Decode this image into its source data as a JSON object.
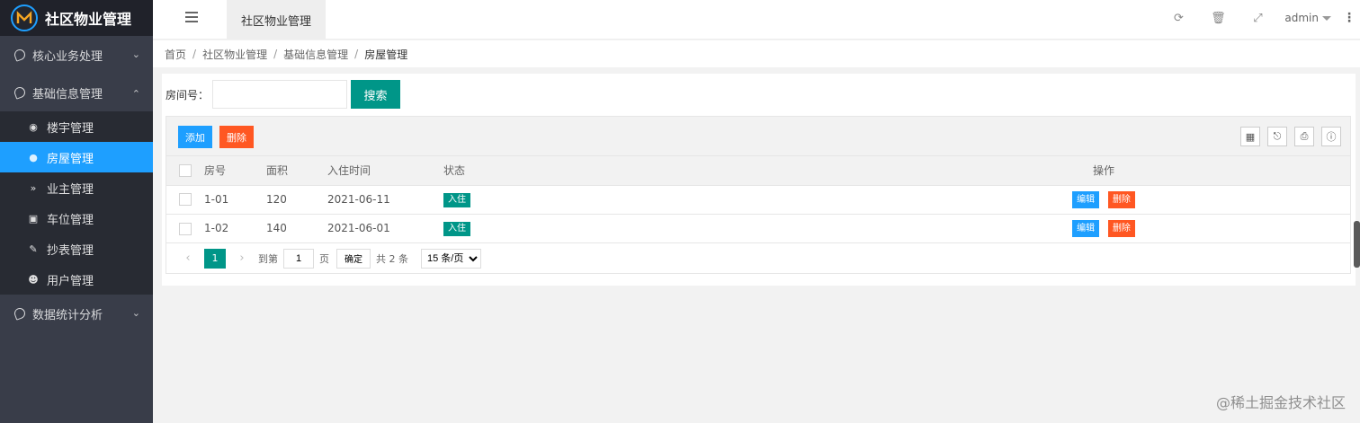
{
  "app": {
    "title": "社区物业管理"
  },
  "sidebar": {
    "groups": [
      {
        "label": "核心业务处理",
        "expanded": false
      },
      {
        "label": "基础信息管理",
        "expanded": true,
        "items": [
          {
            "label": "楼宇管理",
            "icon": "target-icon"
          },
          {
            "label": "房屋管理",
            "icon": "circle-icon",
            "active": true
          },
          {
            "label": "业主管理",
            "icon": "double-chevron-icon"
          },
          {
            "label": "车位管理",
            "icon": "car-icon"
          },
          {
            "label": "抄表管理",
            "icon": "edit-icon"
          },
          {
            "label": "用户管理",
            "icon": "user-circle-icon"
          }
        ]
      },
      {
        "label": "数据统计分析",
        "expanded": false
      }
    ]
  },
  "header": {
    "tab": "社区物业管理",
    "user": "admin"
  },
  "breadcrumb": [
    "首页",
    "社区物业管理",
    "基础信息管理",
    "房屋管理"
  ],
  "search": {
    "label": "房间号：",
    "value": "",
    "placeholder": "",
    "button": "搜索"
  },
  "toolbar": {
    "add": "添加",
    "delete": "删除"
  },
  "table": {
    "columns": [
      "房号",
      "面积",
      "入住时间",
      "状态",
      "操作"
    ],
    "rows": [
      {
        "room": "1-01",
        "area": "120",
        "date": "2021-06-11",
        "status": "入住",
        "edit": "编辑",
        "delete": "删除"
      },
      {
        "room": "1-02",
        "area": "140",
        "date": "2021-06-01",
        "status": "入住",
        "edit": "编辑",
        "delete": "删除"
      }
    ]
  },
  "pager": {
    "current": "1",
    "goto_label": "到第",
    "goto_value": "1",
    "page_unit": "页",
    "confirm": "确定",
    "total": "共 2 条",
    "page_size": "15 条/页"
  },
  "watermark": "@稀土掘金技术社区",
  "colors": {
    "sidebar": "#393d49",
    "accent": "#1e9fff",
    "primary": "#009688",
    "danger": "#ff5722"
  }
}
